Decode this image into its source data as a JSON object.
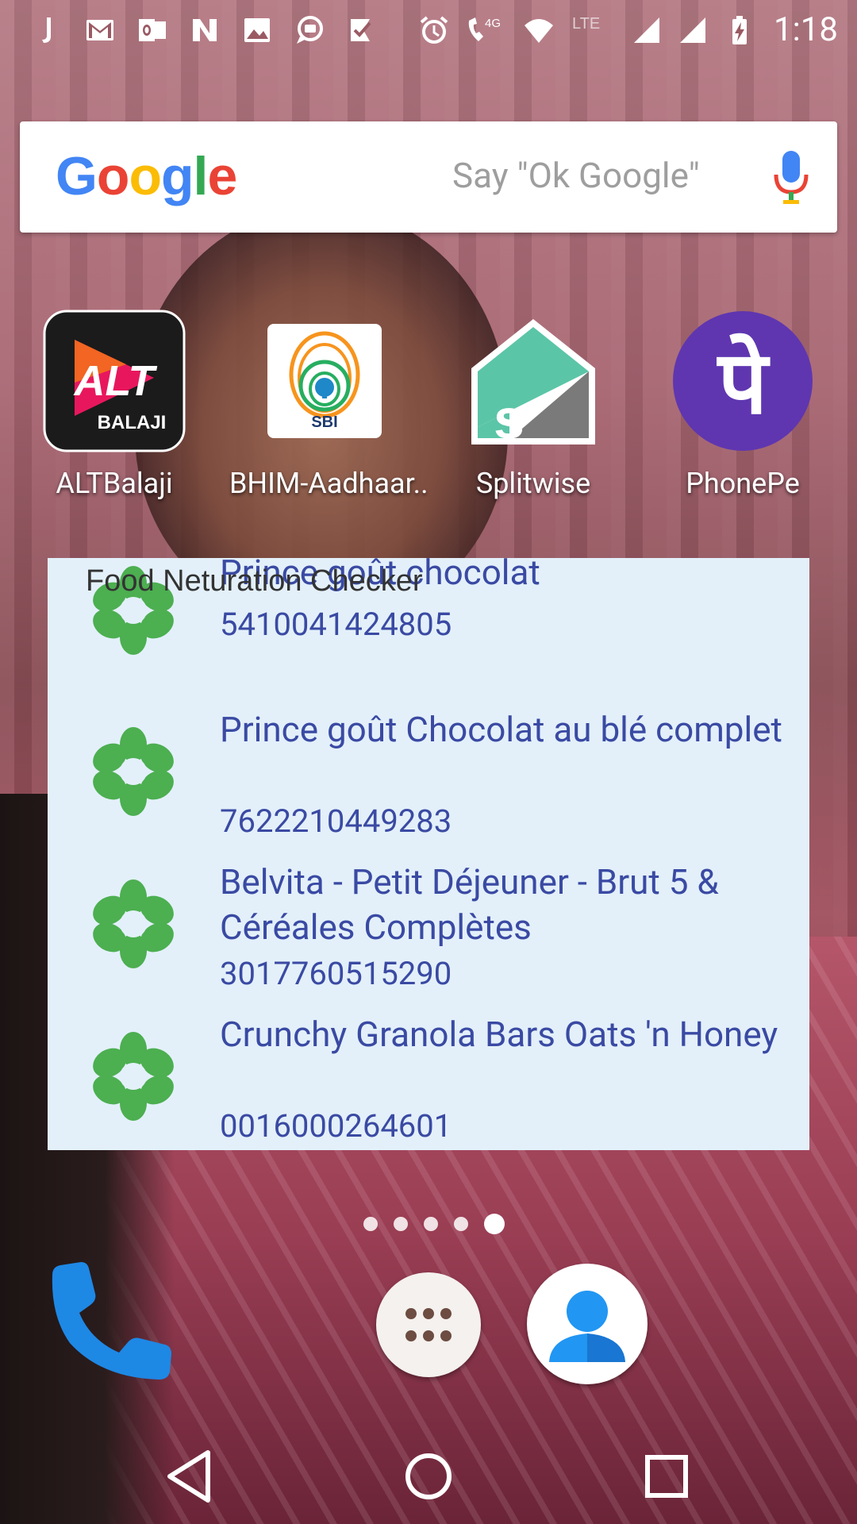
{
  "status_bar": {
    "time": "1:18",
    "network_label": "4G",
    "lte_label": "LTE",
    "left_icons": [
      "j-app-icon",
      "gmail-icon",
      "outlook-icon",
      "n-app-icon",
      "gallery-icon",
      "chat-icon",
      "tasks-icon"
    ],
    "right_icons": [
      "alarm-icon",
      "wifi-call-icon",
      "wifi-icon",
      "signal-icon",
      "signal-icon",
      "battery-charging-icon"
    ]
  },
  "search": {
    "logo_letters": [
      "G",
      "o",
      "o",
      "g",
      "l",
      "e"
    ],
    "hint": "Say \"Ok Google\""
  },
  "apps": [
    {
      "label": "ALTBalaji",
      "icon": "altbalaji-icon",
      "logo_top": "ALT",
      "logo_bottom": "BALAJI"
    },
    {
      "label": "BHIM-Aadhaar..",
      "icon": "bhim-aadhaar-icon",
      "logo_text": "SBI"
    },
    {
      "label": "Splitwise",
      "icon": "splitwise-icon"
    },
    {
      "label": "PhonePe",
      "icon": "phonepe-icon",
      "logo_text": "पे"
    }
  ],
  "widget": {
    "title": "Food Neturation Checker",
    "items": [
      {
        "name": "Prince goût chocolat",
        "code": "5410041424805"
      },
      {
        "name": "Prince goût Chocolat au blé complet",
        "code": "7622210449283"
      },
      {
        "name": "Belvita - Petit Déjeuner - Brut 5 & Céréales Complètes",
        "code": "3017760515290"
      },
      {
        "name": "Crunchy Granola Bars Oats 'n Honey",
        "code": "0016000264601"
      }
    ]
  },
  "page_indicator": {
    "count": 5,
    "active_index": 4
  },
  "dock": [
    "phone-icon",
    "app-drawer-icon",
    "contacts-icon"
  ],
  "nav": [
    "back-icon",
    "home-icon",
    "recents-icon"
  ],
  "colors": {
    "widget_bg": "#e3f0fa",
    "item_text": "#3a4aa3",
    "flower": "#4caf50",
    "phonepe": "#5f36b0",
    "splitwise": "#5bc5a7",
    "altbalaji_bg": "#1b1b1b"
  }
}
